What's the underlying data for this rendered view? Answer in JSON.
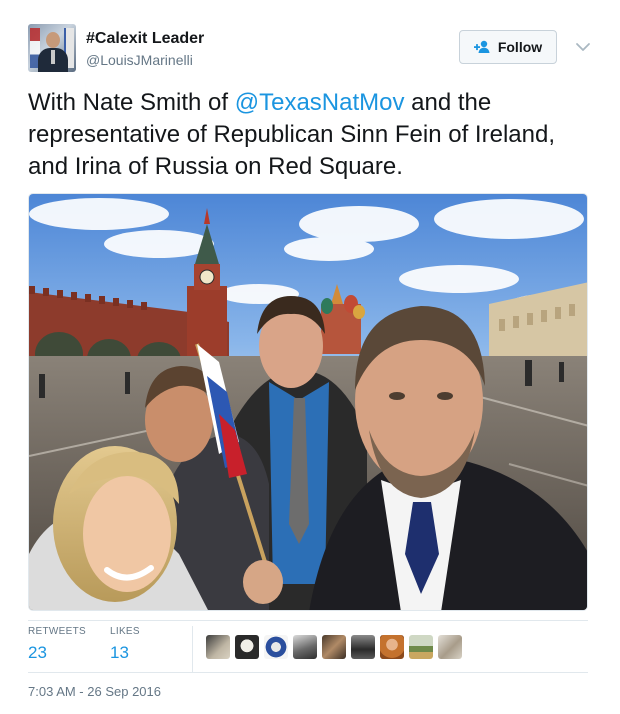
{
  "user": {
    "name": "#Calexit Leader",
    "handle": "@LouisJMarinelli"
  },
  "follow": {
    "label": "Follow"
  },
  "tweet": {
    "text_before": "With Nate Smith of ",
    "mention": "@TexasNatMov",
    "text_after": " and the representative of Republican Sinn Fein of Ireland, and Irina of Russia on Red Square."
  },
  "stats": {
    "retweets_label": "RETWEETS",
    "retweets_value": "23",
    "likes_label": "LIKES",
    "likes_value": "13"
  },
  "likers_count": 9,
  "timestamp": "7:03 AM - 26 Sep 2016",
  "colors": {
    "link": "#1b95e0",
    "text": "#14171a",
    "muted": "#657786",
    "border": "#e1e8ed"
  }
}
